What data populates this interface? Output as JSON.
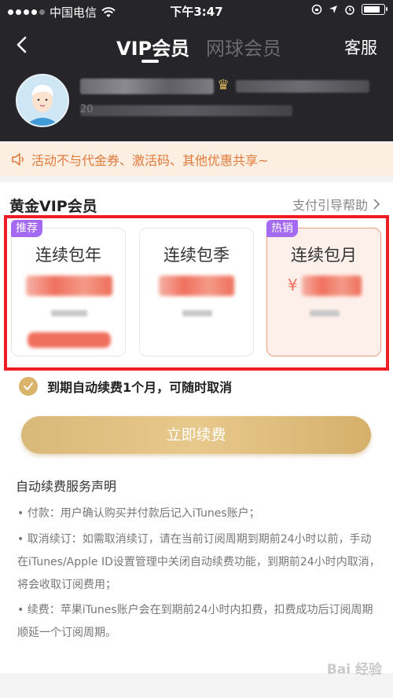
{
  "status_bar": {
    "carrier": "中国电信",
    "time": "下午3:47"
  },
  "header": {
    "tabs": [
      {
        "label": "VIP会员",
        "active": true
      },
      {
        "label": "网球会员",
        "active": false
      }
    ],
    "service_label": "客服"
  },
  "profile": {
    "sub_prefix": "20"
  },
  "notice": {
    "text": "活动不与代金券、激活码、其他优惠共享~"
  },
  "plans": {
    "section_title": "黄金VIP会员",
    "help_label": "支付引导帮助",
    "items": [
      {
        "label": "连续包年",
        "badge": "推荐"
      },
      {
        "label": "连续包季",
        "badge": ""
      },
      {
        "label": "连续包月",
        "badge": "热销",
        "currency": "¥"
      }
    ]
  },
  "auto_renew": {
    "text": "到期自动续费1个月，可随时取消"
  },
  "primary_button": {
    "label": "立即续费"
  },
  "declaration": {
    "title": "自动续费服务声明",
    "lines": [
      "• 付款：用户确认购买并付款后记入iTunes账户；",
      "• 取消续订：如需取消续订，请在当前订阅周期到期前24小时以前，手动在iTunes/Apple ID设置管理中关闭自动续费功能，到期前24小时内取消，将会收取订阅费用；",
      "• 续费：苹果iTunes账户会在到期前24小时内扣费，扣费成功后订阅周期顺延一个订阅周期。"
    ]
  },
  "watermark": "Bai 经验",
  "colors": {
    "header_bg": "#26262a",
    "accent_gold": "#d9b46a",
    "notice_text": "#e07a3a",
    "badge_purple": "#a56af2",
    "highlight_border": "#ee1c25"
  }
}
